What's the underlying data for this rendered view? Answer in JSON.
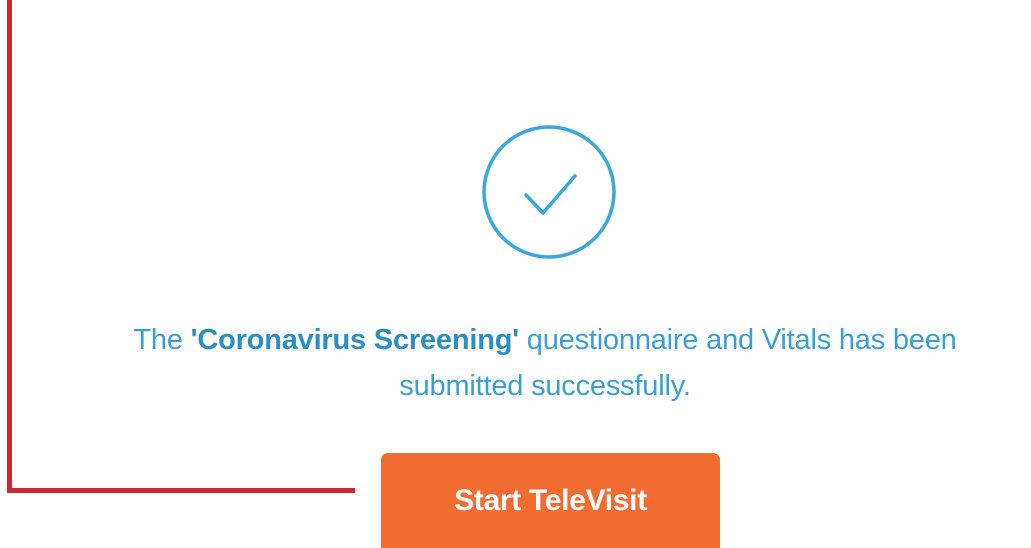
{
  "message": {
    "prefix": "The ",
    "questionnaire_name": "'Coronavirus Screening'",
    "line1_suffix": " questionnaire and Vitals has been",
    "line2": "submitted successfully."
  },
  "icons": {
    "success": "check-circle-icon"
  },
  "actions": {
    "start_label": "Start TeleVisit"
  },
  "colors": {
    "accent_blue": "#3a9fd2",
    "button_orange": "#f26b30",
    "callout_red": "#d0262d"
  }
}
